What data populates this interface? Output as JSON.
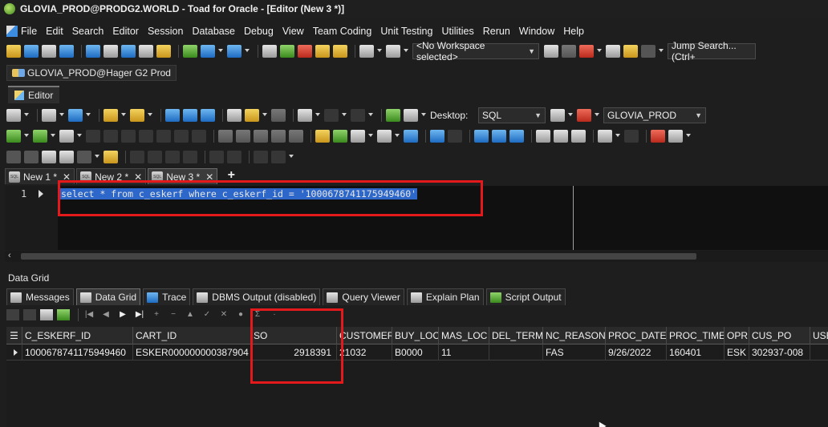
{
  "window": {
    "title": "GLOVIA_PROD@PRODG2.WORLD - Toad for Oracle - [Editor (New 3 *)]"
  },
  "menu": [
    "File",
    "Edit",
    "Search",
    "Editor",
    "Session",
    "Database",
    "Debug",
    "View",
    "Team Coding",
    "Unit Testing",
    "Utilities",
    "Rerun",
    "Window",
    "Help"
  ],
  "toolbar": {
    "workspace": "<No Workspace selected>",
    "jump_search": "Jump Search...(Ctrl+",
    "desktop_label": "Desktop:",
    "desktop_value": "SQL",
    "connection_value": "GLOVIA_PROD"
  },
  "connection_tab": "GLOVIA_PROD@Hager G2 Prod",
  "editor_window_tab": "Editor",
  "doc_tabs": [
    {
      "label": "New 1 *",
      "close": "✕"
    },
    {
      "label": "New 2 *",
      "close": "✕"
    },
    {
      "label": "New 3 *",
      "close": "✕"
    }
  ],
  "new_tab_label": "+",
  "editor": {
    "line_number": "1",
    "sql": "select * from c_eskerf where c_eskerf_id = '1000678741175949460'"
  },
  "results": {
    "pane_title": "Data Grid",
    "tabs": [
      "Messages",
      "Data Grid",
      "Trace",
      "DBMS Output (disabled)",
      "Query Viewer",
      "Explain Plan",
      "Script Output"
    ],
    "active_tab": "Data Grid",
    "columns": [
      "C_ESKERF_ID",
      "CART_ID",
      "SO",
      "CUSTOMER",
      "BUY_LOC",
      "MAS_LOC",
      "DEL_TERM",
      "NC_REASON",
      "PROC_DATE",
      "PROC_TIME",
      "OPR",
      "CUS_PO",
      "USE"
    ],
    "rows": [
      [
        "1000678741175949460",
        "ESKER000000000387904",
        "2918391",
        "21032",
        "B0000",
        "11",
        "",
        "FAS",
        "9/26/2022",
        "160401",
        "ESK",
        "302937-008",
        ""
      ]
    ]
  },
  "colors": {
    "background": "#1e1e1e",
    "selection": "#2c67c9",
    "annotation": "#e3191b"
  }
}
